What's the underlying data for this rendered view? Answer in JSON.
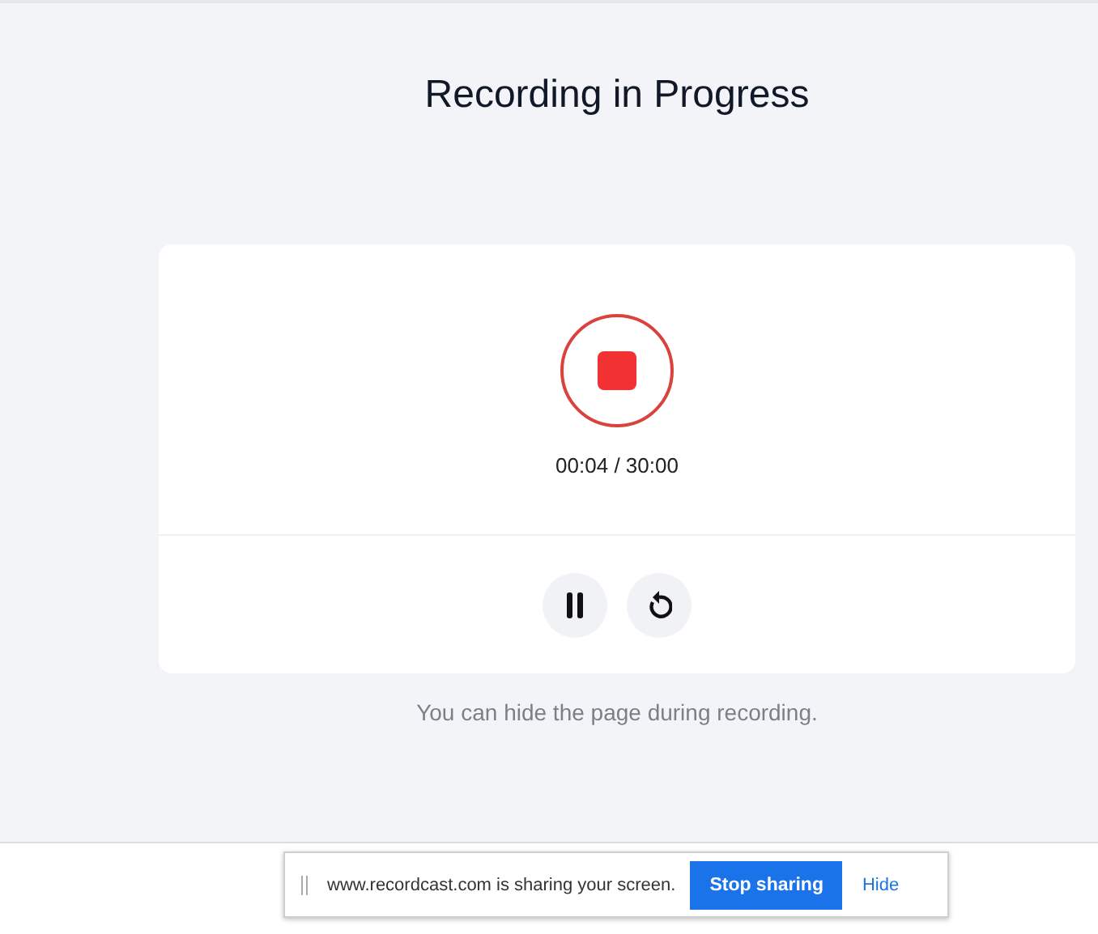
{
  "title": "Recording in Progress",
  "recorder": {
    "timer": "00:04 / 30:00",
    "paused": false
  },
  "hint": "You can hide the page during recording.",
  "share_bar": {
    "message": "www.recordcast.com is sharing your screen.",
    "stop_button": "Stop sharing",
    "hide_link": "Hide"
  }
}
